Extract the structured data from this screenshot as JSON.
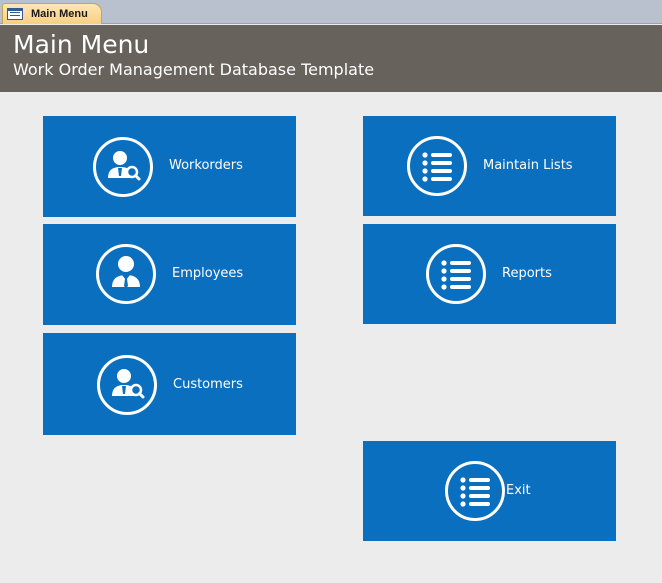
{
  "tab": {
    "label": "Main Menu",
    "icon": "form-icon"
  },
  "header": {
    "title": "Main Menu",
    "subtitle": "Work Order Management Database Template"
  },
  "buttons": {
    "workorders": {
      "label": "Workorders",
      "icon": "user-search-icon"
    },
    "employees": {
      "label": "Employees",
      "icon": "employee-icon"
    },
    "customers": {
      "label": "Customers",
      "icon": "user-search-icon"
    },
    "maintain_lists": {
      "label": "Maintain Lists",
      "icon": "list-icon"
    },
    "reports": {
      "label": "Reports",
      "icon": "list-icon"
    },
    "exit": {
      "label": "Exit",
      "icon": "list-icon"
    }
  },
  "colors": {
    "tile": "#0a6fbe",
    "header": "#67625c",
    "background": "#ececec",
    "tab": "#f8cf7f"
  }
}
